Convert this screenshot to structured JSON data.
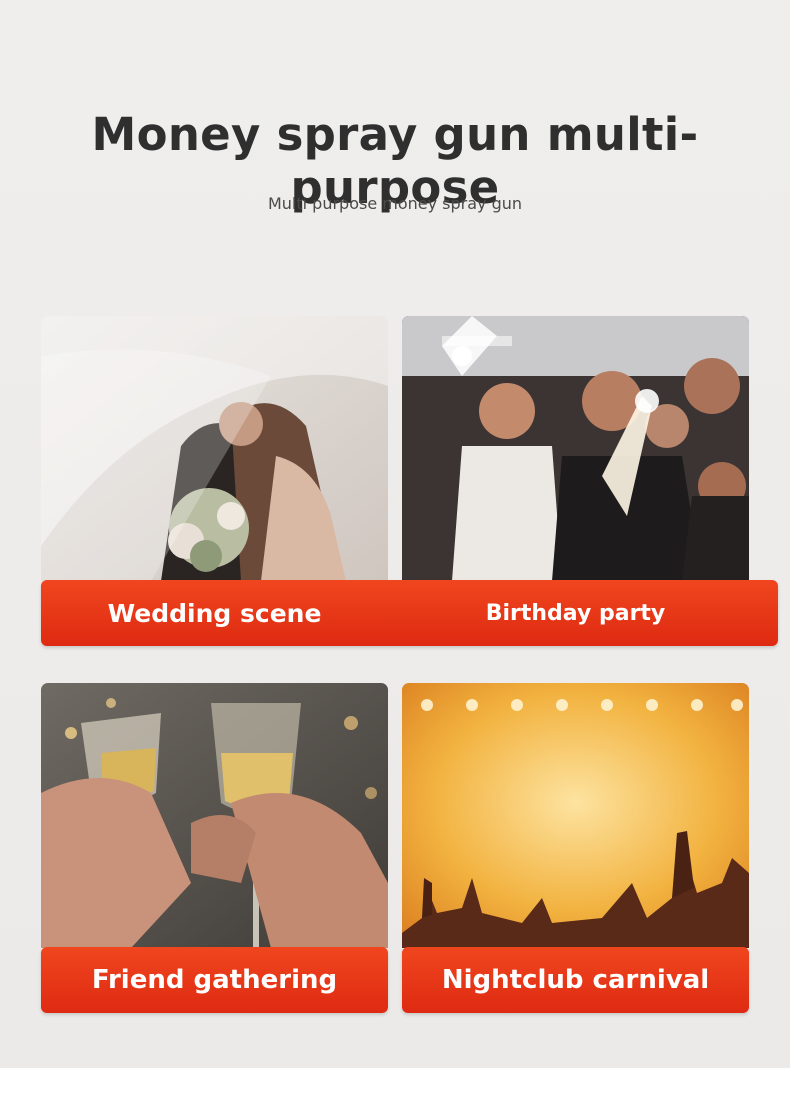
{
  "header": {
    "title": "Money spray gun multi-purpose",
    "subtitle": "Multi purpose money spray gun"
  },
  "cards": [
    {
      "label": "Wedding scene",
      "image": "wedding-couple-photo"
    },
    {
      "label": "Birthday party",
      "image": "birthday-sparklers-photo"
    },
    {
      "label": "Friend gathering",
      "image": "champagne-toast-photo"
    },
    {
      "label": "Nightclub carnival",
      "image": "concert-crowd-photo"
    }
  ],
  "colors": {
    "banner": "#e8361a",
    "title": "#2f2f2f",
    "background": "#eeedeb"
  }
}
